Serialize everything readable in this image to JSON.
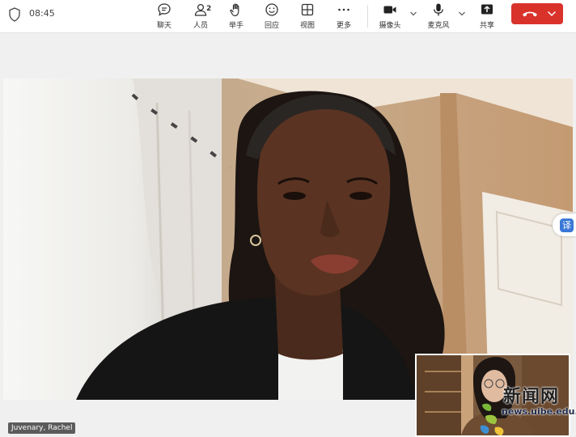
{
  "status": {
    "time": "08:45"
  },
  "toolbar": {
    "chat_label": "聊天",
    "people_label": "人员",
    "people_count": "2",
    "raise_hand_label": "举手",
    "react_label": "回应",
    "view_label": "视图",
    "more_label": "更多",
    "camera_label": "摄像头",
    "mic_label": "麦克风",
    "share_label": "共享",
    "end_call_color": "#d9322b"
  },
  "main_video": {
    "participant_name": "Juvenary, Rachel"
  },
  "translate": {
    "label": "译"
  },
  "watermark": {
    "title": "新闻网",
    "url": "news.uibe.edu.cn"
  }
}
